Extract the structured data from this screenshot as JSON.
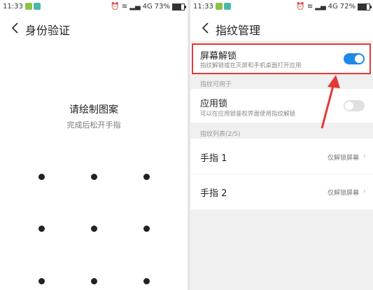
{
  "left_screen": {
    "status": {
      "time": "11:33",
      "network": "4G",
      "battery": "73%",
      "battery_level": 0.73
    },
    "title": "身份验证",
    "prompt": "请绘制图案",
    "hint": "完成后松开手指"
  },
  "right_screen": {
    "status": {
      "time": "11:33",
      "network": "4G",
      "battery": "72%",
      "battery_level": 0.72
    },
    "title": "指纹管理",
    "screen_unlock": {
      "label": "屏幕解锁",
      "desc": "指纹解锁或在灭屏和手机桌面打开应用",
      "enabled": true
    },
    "section_usage": "指纹可用于",
    "app_lock": {
      "label": "应用锁",
      "desc": "可以在应用锁鉴权界面使用指纹解锁",
      "enabled": false
    },
    "section_list": "指纹列表(2/5)",
    "fingers": [
      {
        "label": "手指 1",
        "value": "仅解锁屏幕"
      },
      {
        "label": "手指 2",
        "value": "仅解锁屏幕"
      }
    ]
  },
  "colors": {
    "accent": "#1e88e5",
    "highlight": "#e53935",
    "toggle_off": "#e0e0e0"
  },
  "icons": [
    "back-arrow-icon",
    "alarm-icon",
    "wifi-icon",
    "signal-icon",
    "battery-icon",
    "chevron-right-icon"
  ]
}
